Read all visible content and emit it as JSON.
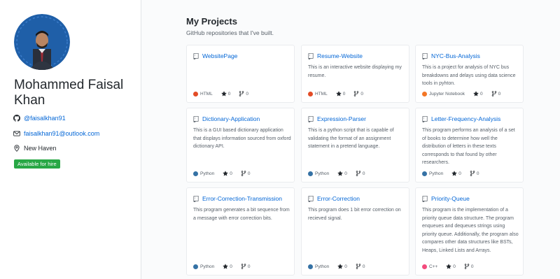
{
  "profile": {
    "name": "Mohammed Faisal Khan",
    "github": "@faisalkhan91",
    "email": "faisalkhan91@outlook.com",
    "location": "New Haven",
    "hire_status": "Available for hire"
  },
  "projects_section": {
    "title": "My Projects",
    "subtitle": "GitHub repositories that I've built."
  },
  "colors": {
    "HTML": "#e34c26",
    "Jupyter Notebook": "#f37626",
    "Python": "#3572A5",
    "C++": "#f34b7d",
    "link": "#0366d6",
    "hire_badge": "#28a745"
  },
  "projects": [
    {
      "name": "WebsitePage",
      "description": "",
      "language": "HTML",
      "stars": "0",
      "forks": "0"
    },
    {
      "name": "Resume-Website",
      "description": "This is an interactive website displaying my resume.",
      "language": "HTML",
      "stars": "0",
      "forks": "0"
    },
    {
      "name": "NYC-Bus-Analysis",
      "description": "This is a project for analysis of NYC bus breakdowns and delays using data science tools in pyhton.",
      "language": "Jupyter Notebook",
      "stars": "0",
      "forks": "0"
    },
    {
      "name": "Dictionary-Application",
      "description": "This is a GUI based dictionary application that displays information sourced from oxford dictionary API.",
      "language": "Python",
      "stars": "0",
      "forks": "0"
    },
    {
      "name": "Expression-Parser",
      "description": "This is a python script that is capable of validating the format of an assignment statement in a pretend language.",
      "language": "Python",
      "stars": "0",
      "forks": "0"
    },
    {
      "name": "Letter-Frequency-Analysis",
      "description": "This program performs an analysis of a set of books to determine how well the distribution of letters in these texts corresponds to that found by other researchers.",
      "language": "Python",
      "stars": "0",
      "forks": "0"
    },
    {
      "name": "Error-Correction-Transmission",
      "description": "This program generates a bit sequence from a message with error correction bits.",
      "language": "Python",
      "stars": "0",
      "forks": "0"
    },
    {
      "name": "Error-Correction",
      "description": "This program does 1 bit error correction on recieved signal.",
      "language": "Python",
      "stars": "0",
      "forks": "0"
    },
    {
      "name": "Priority-Queue",
      "description": "This program is the implementation of a priority queue data structure. The program enqueues and dequeues strings using priority queue. Additionally, the program also compares other data structures like BSTs, Heaps, Linked Lists and Arrays.",
      "language": "C++",
      "stars": "0",
      "forks": "0"
    }
  ]
}
